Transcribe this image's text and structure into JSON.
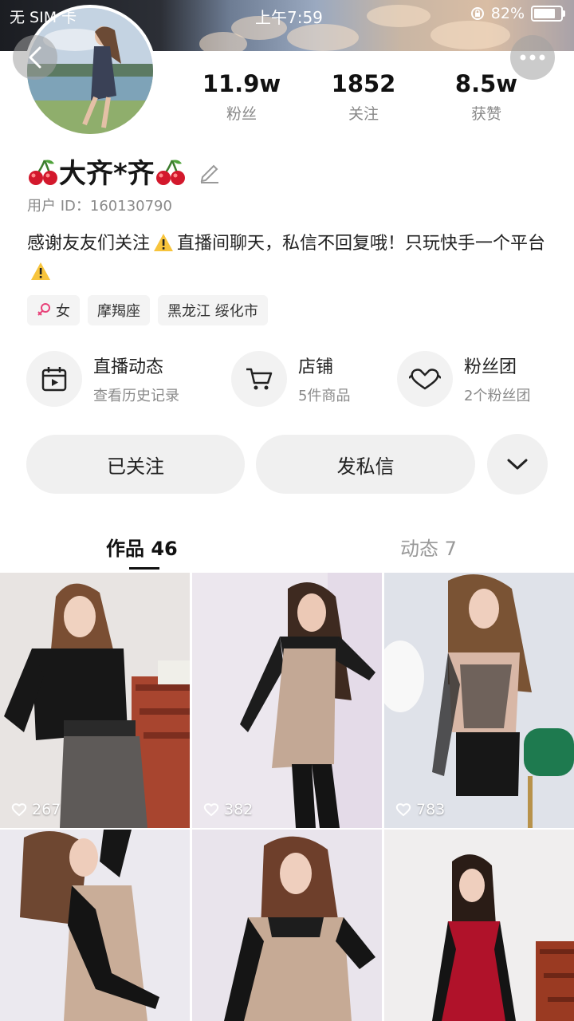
{
  "status_bar": {
    "carrier": "无 SIM 卡",
    "time": "上午7:59",
    "battery": "82%",
    "battery_level": 0.82
  },
  "profile": {
    "stats": [
      {
        "value": "11.9w",
        "label": "粉丝"
      },
      {
        "value": "1852",
        "label": "关注"
      },
      {
        "value": "8.5w",
        "label": "获赞"
      }
    ],
    "name": "大齐*齐",
    "user_id": "用户 ID：160130790",
    "bio_part1": "感谢友友们关注",
    "bio_part2": "直播间聊天，私信不回复哦！只玩快手一个平台",
    "tags": [
      {
        "label": "女",
        "icon": "female-icon"
      },
      {
        "label": "摩羯座"
      },
      {
        "label": "黑龙江 绥化市"
      }
    ]
  },
  "features": [
    {
      "title": "直播动态",
      "subtitle": "查看历史记录",
      "icon": "calendar-play-icon"
    },
    {
      "title": "店铺",
      "subtitle": "5件商品",
      "icon": "cart-icon"
    },
    {
      "title": "粉丝团",
      "subtitle": "2个粉丝团",
      "icon": "heart-icon"
    }
  ],
  "actions": {
    "followed": "已关注",
    "message": "发私信"
  },
  "tabs": {
    "works": "作品 46",
    "moments": "动态 7"
  },
  "posts": [
    {
      "likes": "267"
    },
    {
      "likes": "382"
    },
    {
      "likes": "783"
    },
    {
      "likes": ""
    },
    {
      "likes": ""
    },
    {
      "likes": ""
    }
  ],
  "colors": {
    "accent_pink": "#e8437a",
    "warning_yellow": "#f7c43c"
  }
}
